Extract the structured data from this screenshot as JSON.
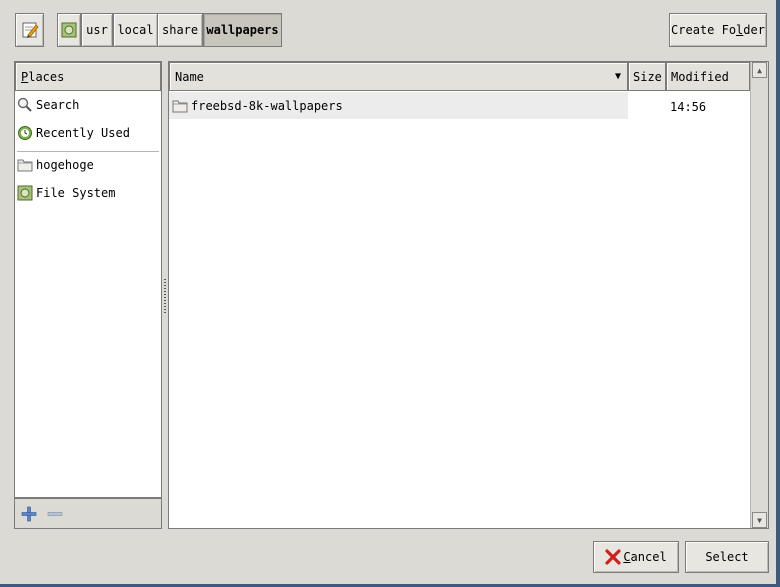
{
  "toolbar": {
    "create_folder_label": "Create Folder",
    "create_folder_mnemonic_prefix": "Create Fo",
    "create_folder_mnemonic_char": "l",
    "create_folder_mnemonic_suffix": "der"
  },
  "path_bar": [
    "usr",
    "local",
    "share",
    "wallpapers"
  ],
  "places": {
    "header_mnemonic": "P",
    "header_rest": "laces",
    "items": [
      {
        "label": "Search",
        "icon": "search-icon"
      },
      {
        "label": "Recently Used",
        "icon": "recent-icon"
      },
      {
        "label": "hogehoge",
        "icon": "folder-icon"
      },
      {
        "label": "File System",
        "icon": "drive-icon"
      }
    ],
    "add_icon": "plus-icon",
    "remove_icon": "minus-icon"
  },
  "files": {
    "columns": {
      "name": "Name",
      "size": "Size",
      "modified": "Modified"
    },
    "rows": [
      {
        "name": "freebsd-8k-wallpapers",
        "size": "",
        "modified": "14:56"
      }
    ]
  },
  "actions": {
    "cancel_mnemonic": "C",
    "cancel_rest": "ancel",
    "select_label": "Select"
  },
  "colors": {
    "dialog_bg": "#dcdad5",
    "desktop_bg": "#3e5a7c",
    "selected_row": "#ececec",
    "cancel_icon": "#d02020"
  }
}
